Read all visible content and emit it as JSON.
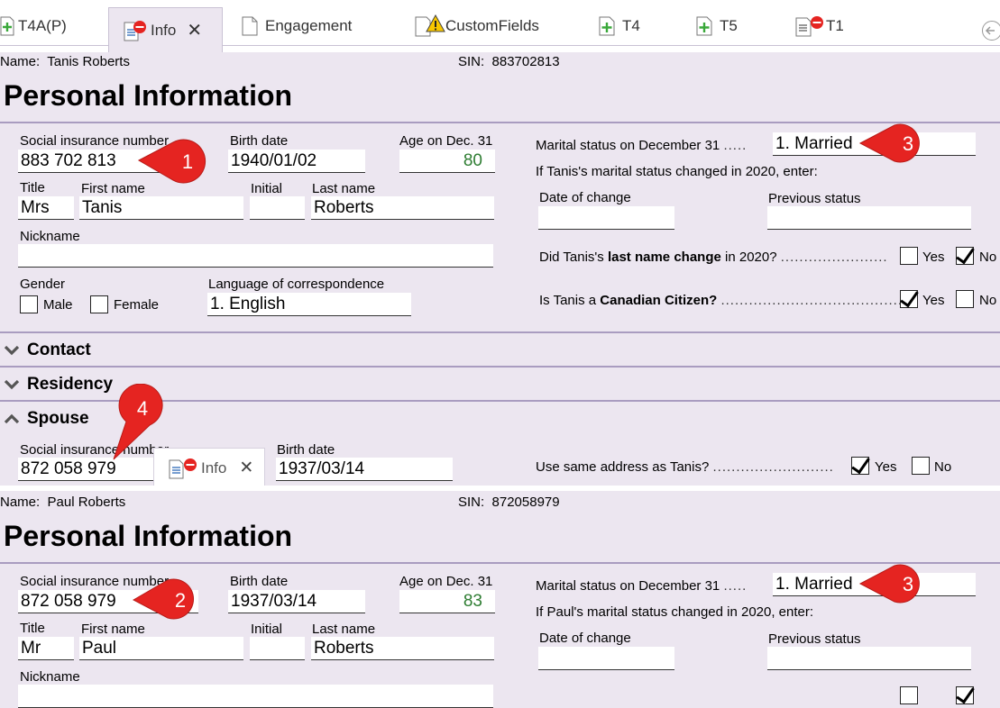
{
  "tabs": [
    {
      "label": "T4A(P)",
      "icon": "plus-doc-icon"
    },
    {
      "label": "Info",
      "icon": "doc-minus-icon"
    },
    {
      "label": "Engagement",
      "icon": "doc-icon"
    },
    {
      "label": "CustomFields",
      "icon": "doc-warning-icon"
    },
    {
      "label": "T4",
      "icon": "plus-doc-icon"
    },
    {
      "label": "T5",
      "icon": "plus-doc-icon"
    },
    {
      "label": "T1",
      "icon": "doc-minus-icon"
    }
  ],
  "close_glyph": "✕",
  "top": {
    "name_label": "Name:",
    "name_value": "Tanis Roberts",
    "sin_label": "SIN:",
    "sin_value": "883702813",
    "heading": "Personal Information",
    "sin_field_label": "Social insurance number",
    "sin_field": "883 702 813",
    "birth_label": "Birth date",
    "birth_value": "1940/01/02",
    "age_label": "Age on Dec. 31",
    "age_value": "80",
    "title_label": "Title",
    "title_value": "Mrs",
    "first_label": "First name",
    "first_value": "Tanis",
    "initial_label": "Initial",
    "initial_value": "",
    "last_label": "Last name",
    "last_value": "Roberts",
    "nickname_label": "Nickname",
    "nickname_value": "",
    "gender_label": "Gender",
    "male_label": "Male",
    "female_label": "Female",
    "lang_label": "Language of correspondence",
    "lang_value": "1. English",
    "marital_label": "Marital status on December 31",
    "marital_value": "1. Married",
    "changed_text": "If Tanis's marital status changed in 2020, enter:",
    "date_change_label": "Date of change",
    "prev_status_label": "Previous status",
    "lastname_q_pre": "Did Tanis's ",
    "lastname_q_bold": "last name change",
    "lastname_q_post": " in 2020?",
    "citizen_q_pre": "Is Tanis a ",
    "citizen_q_bold": "Canadian Citizen?",
    "yes_label": "Yes",
    "no_label": "No",
    "lastname_changed": false,
    "citizen": true
  },
  "sections": {
    "contact": "Contact",
    "residency": "Residency",
    "spouse": "Spouse"
  },
  "spouse_row": {
    "sin_label": "Social insurance number",
    "sin_value": "872 058 979",
    "birth_label": "Birth date",
    "birth_value": "1937/03/14",
    "same_address_q": "Use same address as Tanis?",
    "yes_label": "Yes",
    "no_label": "No",
    "same_address": true
  },
  "popup_tab": {
    "label": "Info",
    "icon": "doc-minus-icon",
    "close": "✕"
  },
  "bottom": {
    "name_label": "Name:",
    "name_value": "Paul Roberts",
    "sin_label": "SIN:",
    "sin_value": "872058979",
    "heading": "Personal Information",
    "sin_field_label": "Social insurance number",
    "sin_field": "872 058 979",
    "birth_label": "Birth date",
    "birth_value": "1937/03/14",
    "age_label": "Age on Dec. 31",
    "age_value": "83",
    "title_label": "Title",
    "title_value": "Mr",
    "first_label": "First name",
    "first_value": "Paul",
    "initial_label": "Initial",
    "initial_value": "",
    "last_label": "Last name",
    "last_value": "Roberts",
    "nickname_label": "Nickname",
    "marital_label": "Marital status on December 31",
    "marital_value": "1. Married",
    "changed_text": "If Paul's marital status changed in 2020, enter:",
    "date_change_label": "Date of change",
    "prev_status_label": "Previous status"
  },
  "callouts": [
    "1",
    "3",
    "4",
    "2",
    "3"
  ],
  "colors": {
    "callout": "#e52421",
    "panel": "#ece6f0",
    "rule": "#a99cc0",
    "age": "#2e7d32"
  }
}
